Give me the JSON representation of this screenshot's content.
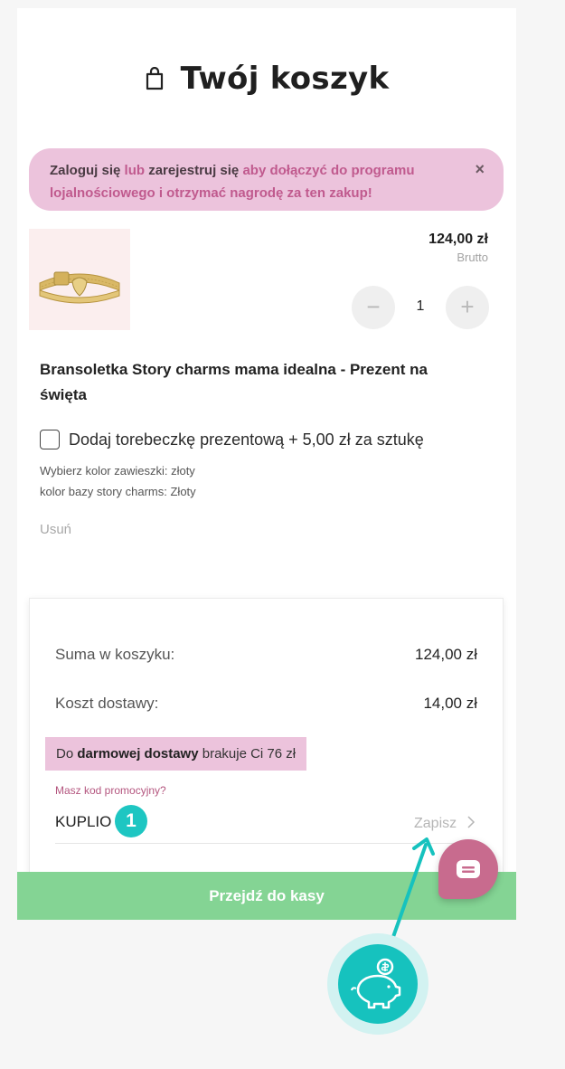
{
  "header": {
    "title": "Twój koszyk",
    "icon": "shopping-bag-icon"
  },
  "loyalty_banner": {
    "login": "Zaloguj się",
    "or": "lub",
    "register": "zarejestruj się",
    "rest": "aby dołączyć do programu lojalnościowego i otrzymać nagrodę za ten zakup!",
    "close": "×"
  },
  "cart_item": {
    "price": "124,00 zł",
    "price_note": "Brutto",
    "quantity": "1",
    "minus": "−",
    "plus": "+",
    "name": "Bransoletka Story charms mama idealna - Prezent na święta",
    "gift_option": "Dodaj torebeczkę prezentową + 5,00 zł za sztukę",
    "option_1": "Wybierz kolor zawieszki: złoty",
    "option_2": "kolor bazy story charms: Złoty",
    "remove": "Usuń"
  },
  "summary": {
    "subtotal_label": "Suma w koszyku:",
    "subtotal_value": "124,00 zł",
    "shipping_label": "Koszt dostawy:",
    "shipping_value": "14,00 zł",
    "free_shipping_prefix": "Do",
    "free_shipping_bold": "darmowej dostawy",
    "free_shipping_suffix": "brakuje Ci 76 zł",
    "promo_label": "Masz kod promocyjny?",
    "promo_value": "KUPLIO",
    "promo_badge": "1",
    "save_label": "Zapisz",
    "checkout_label": "Przejdź do kasy"
  },
  "colors": {
    "accent_pink": "#ecc3dc",
    "checkout_green": "#84d494",
    "teal": "#16c2be",
    "chat_pink": "#c86b8e"
  }
}
